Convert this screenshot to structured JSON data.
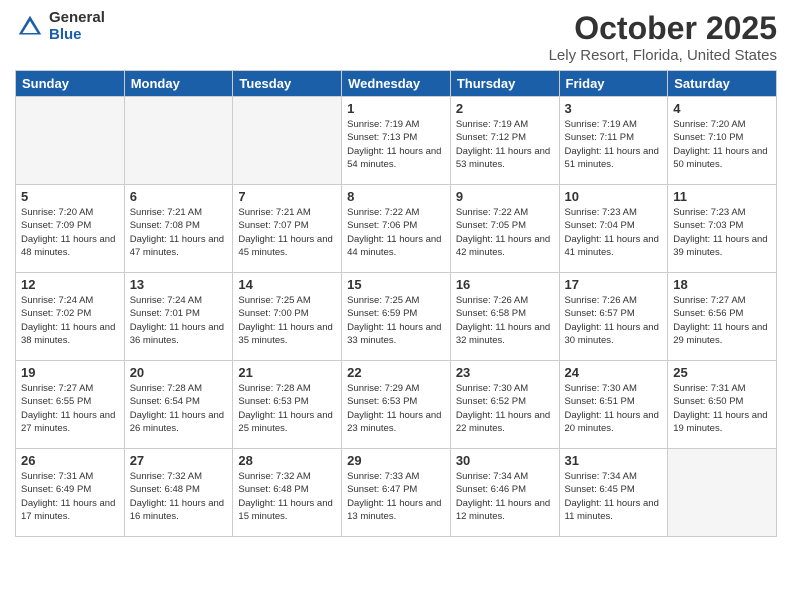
{
  "header": {
    "logo_general": "General",
    "logo_blue": "Blue",
    "month_title": "October 2025",
    "location": "Lely Resort, Florida, United States"
  },
  "weekdays": [
    "Sunday",
    "Monday",
    "Tuesday",
    "Wednesday",
    "Thursday",
    "Friday",
    "Saturday"
  ],
  "weeks": [
    [
      {
        "day": "",
        "empty": true
      },
      {
        "day": "",
        "empty": true
      },
      {
        "day": "",
        "empty": true
      },
      {
        "day": "1",
        "sunrise": "7:19 AM",
        "sunset": "7:13 PM",
        "daylight": "11 hours and 54 minutes."
      },
      {
        "day": "2",
        "sunrise": "7:19 AM",
        "sunset": "7:12 PM",
        "daylight": "11 hours and 53 minutes."
      },
      {
        "day": "3",
        "sunrise": "7:19 AM",
        "sunset": "7:11 PM",
        "daylight": "11 hours and 51 minutes."
      },
      {
        "day": "4",
        "sunrise": "7:20 AM",
        "sunset": "7:10 PM",
        "daylight": "11 hours and 50 minutes."
      }
    ],
    [
      {
        "day": "5",
        "sunrise": "7:20 AM",
        "sunset": "7:09 PM",
        "daylight": "11 hours and 48 minutes."
      },
      {
        "day": "6",
        "sunrise": "7:21 AM",
        "sunset": "7:08 PM",
        "daylight": "11 hours and 47 minutes."
      },
      {
        "day": "7",
        "sunrise": "7:21 AM",
        "sunset": "7:07 PM",
        "daylight": "11 hours and 45 minutes."
      },
      {
        "day": "8",
        "sunrise": "7:22 AM",
        "sunset": "7:06 PM",
        "daylight": "11 hours and 44 minutes."
      },
      {
        "day": "9",
        "sunrise": "7:22 AM",
        "sunset": "7:05 PM",
        "daylight": "11 hours and 42 minutes."
      },
      {
        "day": "10",
        "sunrise": "7:23 AM",
        "sunset": "7:04 PM",
        "daylight": "11 hours and 41 minutes."
      },
      {
        "day": "11",
        "sunrise": "7:23 AM",
        "sunset": "7:03 PM",
        "daylight": "11 hours and 39 minutes."
      }
    ],
    [
      {
        "day": "12",
        "sunrise": "7:24 AM",
        "sunset": "7:02 PM",
        "daylight": "11 hours and 38 minutes."
      },
      {
        "day": "13",
        "sunrise": "7:24 AM",
        "sunset": "7:01 PM",
        "daylight": "11 hours and 36 minutes."
      },
      {
        "day": "14",
        "sunrise": "7:25 AM",
        "sunset": "7:00 PM",
        "daylight": "11 hours and 35 minutes."
      },
      {
        "day": "15",
        "sunrise": "7:25 AM",
        "sunset": "6:59 PM",
        "daylight": "11 hours and 33 minutes."
      },
      {
        "day": "16",
        "sunrise": "7:26 AM",
        "sunset": "6:58 PM",
        "daylight": "11 hours and 32 minutes."
      },
      {
        "day": "17",
        "sunrise": "7:26 AM",
        "sunset": "6:57 PM",
        "daylight": "11 hours and 30 minutes."
      },
      {
        "day": "18",
        "sunrise": "7:27 AM",
        "sunset": "6:56 PM",
        "daylight": "11 hours and 29 minutes."
      }
    ],
    [
      {
        "day": "19",
        "sunrise": "7:27 AM",
        "sunset": "6:55 PM",
        "daylight": "11 hours and 27 minutes."
      },
      {
        "day": "20",
        "sunrise": "7:28 AM",
        "sunset": "6:54 PM",
        "daylight": "11 hours and 26 minutes."
      },
      {
        "day": "21",
        "sunrise": "7:28 AM",
        "sunset": "6:53 PM",
        "daylight": "11 hours and 25 minutes."
      },
      {
        "day": "22",
        "sunrise": "7:29 AM",
        "sunset": "6:53 PM",
        "daylight": "11 hours and 23 minutes."
      },
      {
        "day": "23",
        "sunrise": "7:30 AM",
        "sunset": "6:52 PM",
        "daylight": "11 hours and 22 minutes."
      },
      {
        "day": "24",
        "sunrise": "7:30 AM",
        "sunset": "6:51 PM",
        "daylight": "11 hours and 20 minutes."
      },
      {
        "day": "25",
        "sunrise": "7:31 AM",
        "sunset": "6:50 PM",
        "daylight": "11 hours and 19 minutes."
      }
    ],
    [
      {
        "day": "26",
        "sunrise": "7:31 AM",
        "sunset": "6:49 PM",
        "daylight": "11 hours and 17 minutes."
      },
      {
        "day": "27",
        "sunrise": "7:32 AM",
        "sunset": "6:48 PM",
        "daylight": "11 hours and 16 minutes."
      },
      {
        "day": "28",
        "sunrise": "7:32 AM",
        "sunset": "6:48 PM",
        "daylight": "11 hours and 15 minutes."
      },
      {
        "day": "29",
        "sunrise": "7:33 AM",
        "sunset": "6:47 PM",
        "daylight": "11 hours and 13 minutes."
      },
      {
        "day": "30",
        "sunrise": "7:34 AM",
        "sunset": "6:46 PM",
        "daylight": "11 hours and 12 minutes."
      },
      {
        "day": "31",
        "sunrise": "7:34 AM",
        "sunset": "6:45 PM",
        "daylight": "11 hours and 11 minutes."
      },
      {
        "day": "",
        "empty": true
      }
    ]
  ]
}
